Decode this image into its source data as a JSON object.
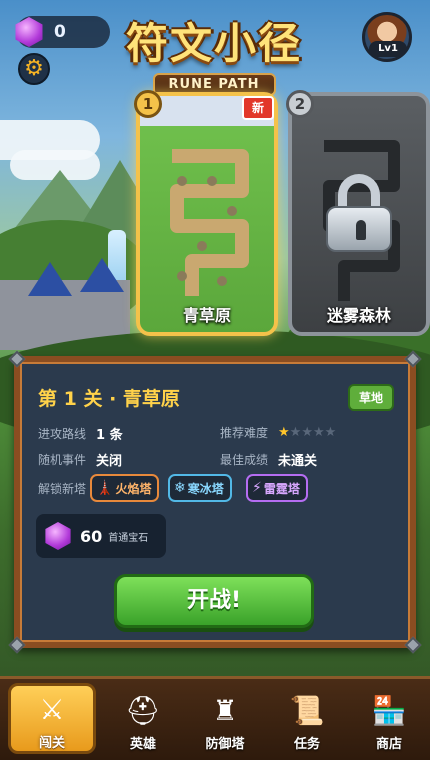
{
  "header": {
    "gem_count": "0",
    "logo_cn": "符文小径",
    "logo_en": "RUNE PATH",
    "level_badge": "Lv1"
  },
  "levels": [
    {
      "number": "1",
      "name": "青草原",
      "new_badge": "新",
      "locked": false
    },
    {
      "number": "2",
      "name": "迷雾森林",
      "locked": true
    }
  ],
  "stage": {
    "title": "第 1 关 · 青草原",
    "terrain": "草地",
    "rows": {
      "route_label": "进攻路线",
      "route_value": "1 条",
      "difficulty_label": "推荐难度",
      "difficulty_stars": 1,
      "difficulty_max": 5,
      "event_label": "随机事件",
      "event_value": "关闭",
      "best_label": "最佳成绩",
      "best_value": "未通关",
      "unlock_label": "解锁新塔"
    },
    "towers": [
      {
        "name": "火焰塔",
        "icon": "fire-tower-icon",
        "color": "#e8893b"
      },
      {
        "name": "寒冰塔",
        "icon": "ice-tower-icon",
        "color": "#52b8e6"
      },
      {
        "name": "雷霆塔",
        "icon": "thunder-tower-icon",
        "color": "#b56df2"
      }
    ],
    "reward_value": "60",
    "reward_label": "首通宝石",
    "start_label": "开战!"
  },
  "nav": [
    {
      "label": "闯关",
      "icon": "sword-shield-icon",
      "active": true
    },
    {
      "label": "英雄",
      "icon": "helmet-icon",
      "active": false
    },
    {
      "label": "防御塔",
      "icon": "tower-icon",
      "active": false
    },
    {
      "label": "任务",
      "icon": "scroll-icon",
      "active": false
    },
    {
      "label": "商店",
      "icon": "shop-icon",
      "active": false
    }
  ]
}
